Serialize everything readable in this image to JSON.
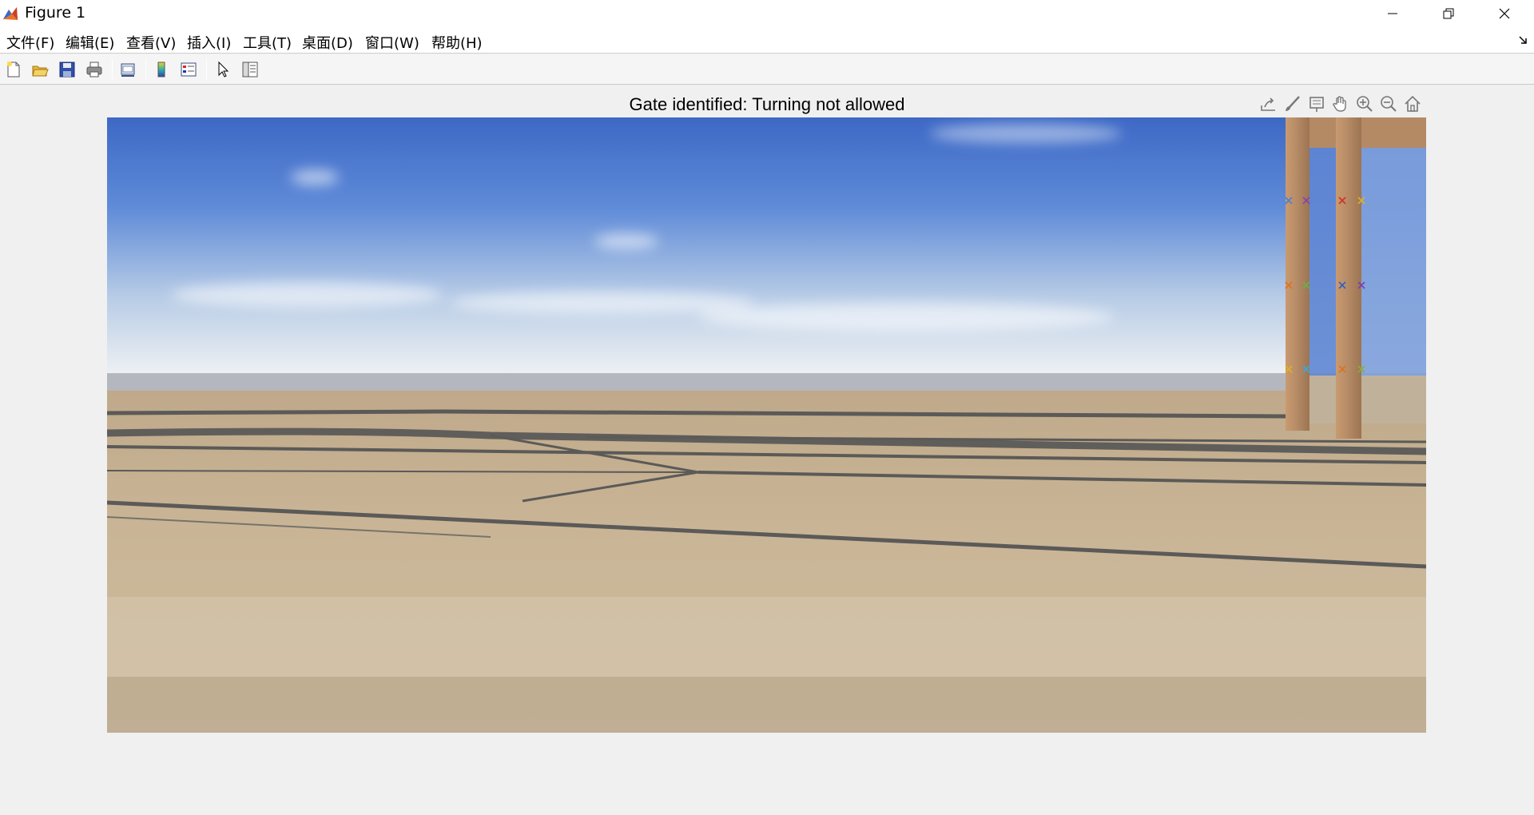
{
  "window": {
    "title": "Figure 1",
    "icon": "matlab-icon"
  },
  "menu": {
    "items": [
      {
        "label": "文件(F)"
      },
      {
        "label": "编辑(E)"
      },
      {
        "label": "查看(V)"
      },
      {
        "label": "插入(I)"
      },
      {
        "label": "工具(T)"
      },
      {
        "label": "桌面(D)"
      },
      {
        "label": "窗口(W)"
      },
      {
        "label": "帮助(H)"
      }
    ]
  },
  "toolbar": {
    "buttons": [
      {
        "icon": "new-figure-icon"
      },
      {
        "icon": "open-file-icon"
      },
      {
        "icon": "save-icon"
      },
      {
        "icon": "print-icon"
      },
      {
        "icon": "link-plot-icon"
      },
      {
        "icon": "colorbar-icon"
      },
      {
        "icon": "legend-icon"
      },
      {
        "icon": "pointer-icon"
      },
      {
        "icon": "property-inspector-icon"
      }
    ]
  },
  "axes": {
    "title": "Gate identified: Turning not allowed",
    "toolbar": [
      "export-icon",
      "brush-icon",
      "data-tips-icon",
      "pan-icon",
      "zoom-in-icon",
      "zoom-out-icon",
      "home-icon"
    ]
  },
  "colors": {
    "sky_top": "#3f6cc6",
    "sky_horizon": "#e6ebf0",
    "ground": "#c8b494",
    "gate_post": "#b48a65"
  }
}
